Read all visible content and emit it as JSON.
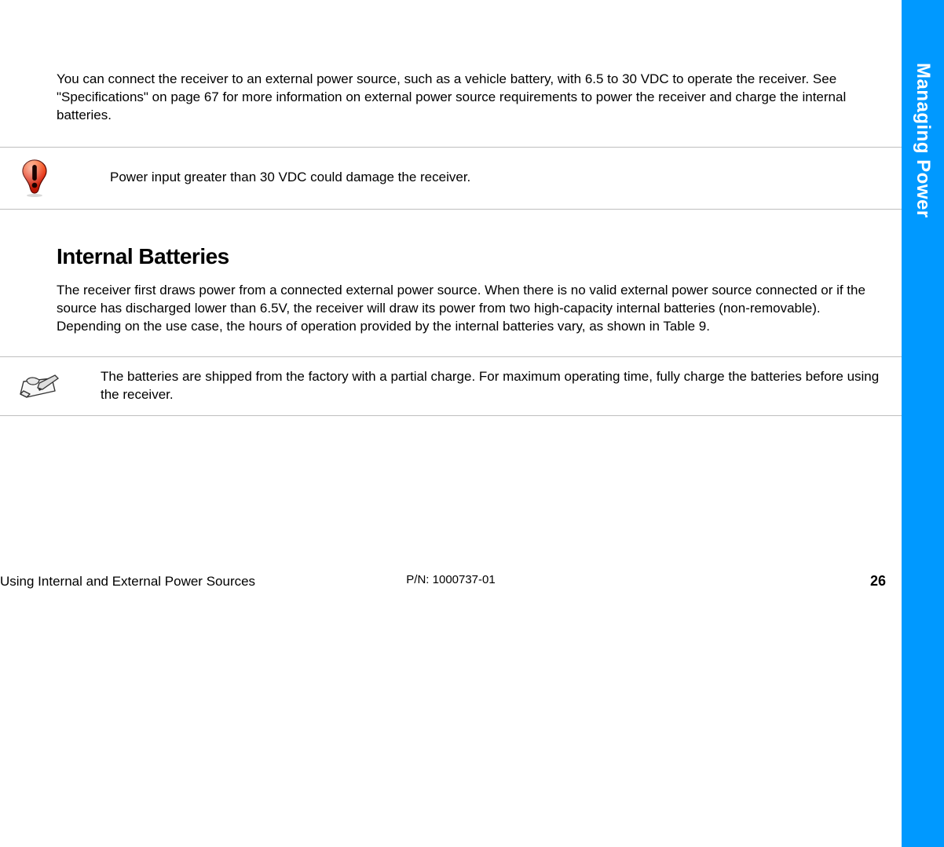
{
  "sideTab": "Managing Power",
  "intro": "You can connect the receiver to an external power source, such as a vehicle battery, with 6.5 to 30 VDC to operate the receiver. See \"Specifications\" on page 67 for more information on external power source requirements to power the receiver and charge the internal batteries.",
  "warning": "Power input greater than 30 VDC could damage the receiver.",
  "sectionHeading": "Internal Batteries",
  "sectionBody": "The receiver first draws power from a connected external power source. When there is no valid external power source connected or if the source has discharged lower than 6.5V, the receiver will draw its power from two high-capacity internal batteries (non-removable). Depending on the use case, the hours of operation provided by the internal batteries vary, as shown in Table 9.",
  "note": "The batteries are shipped from the factory with a partial charge. For maximum operating time, fully charge the batteries before using the receiver.",
  "footer": {
    "left": "Using Internal and External Power Sources",
    "center": "P/N: 1000737-01",
    "right": "26"
  }
}
